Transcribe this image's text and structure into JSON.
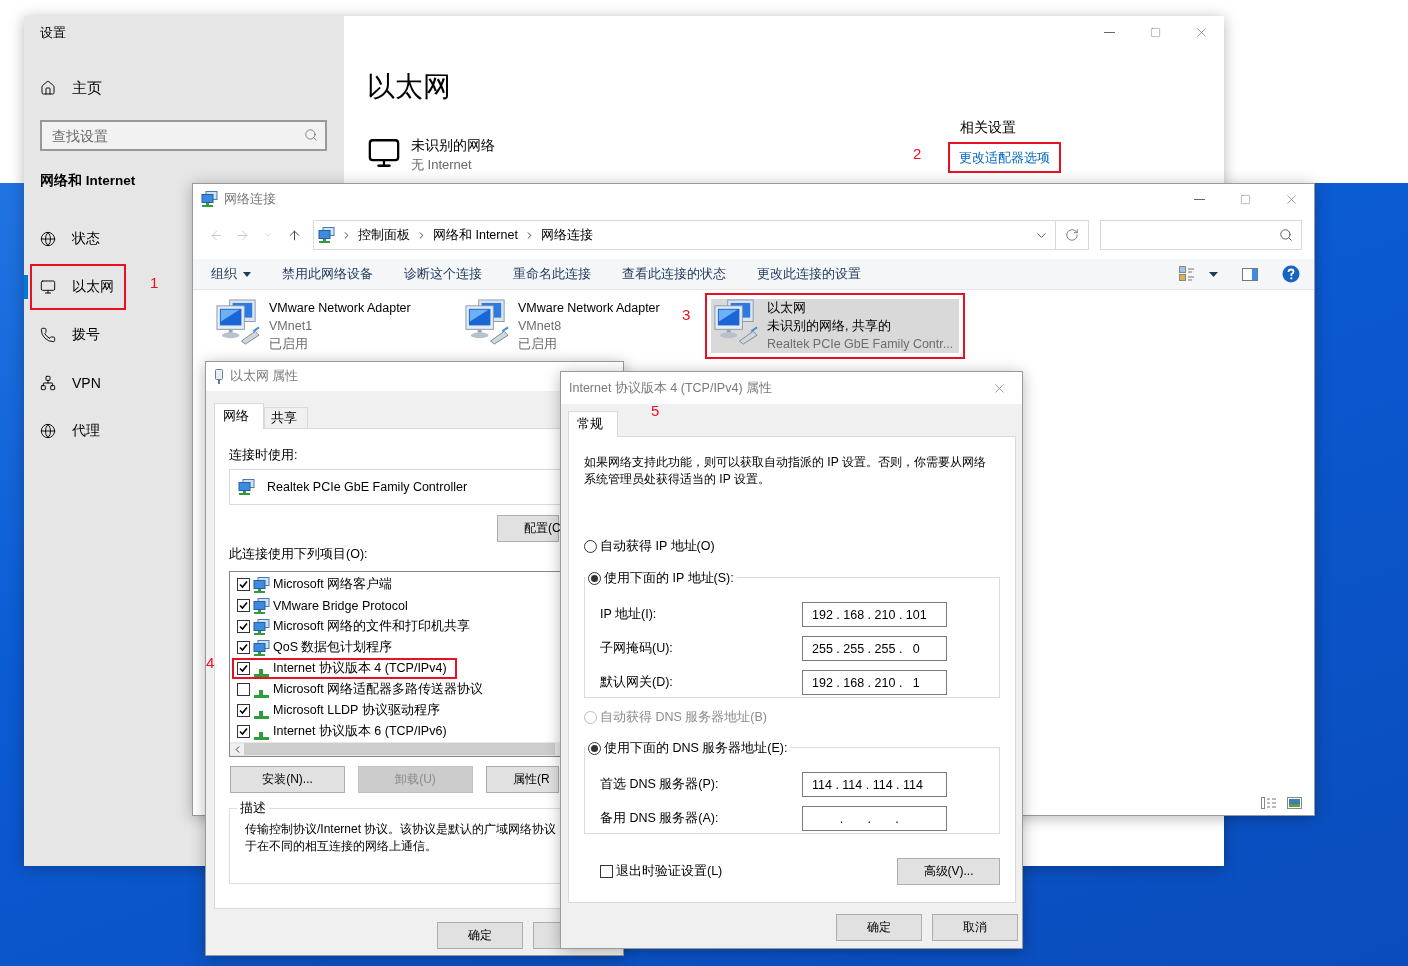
{
  "settings": {
    "title": "设置",
    "home": "主页",
    "search": {
      "placeholder": "查找设置"
    },
    "section": "网络和 Internet",
    "nav": [
      {
        "label": "状态",
        "kind": "status",
        "selected": false,
        "highlighted": false
      },
      {
        "label": "以太网",
        "kind": "ethernet",
        "selected": true,
        "highlighted": true
      },
      {
        "label": "拨号",
        "kind": "dialup",
        "selected": false,
        "highlighted": false
      },
      {
        "label": "VPN",
        "kind": "vpn",
        "selected": false,
        "highlighted": false
      },
      {
        "label": "代理",
        "kind": "proxy",
        "selected": false,
        "highlighted": false
      }
    ],
    "page_title": "以太网",
    "network": {
      "name": "未识别的网络",
      "status": "无 Internet"
    },
    "related": {
      "heading": "相关设置",
      "link": "更改适配器选项",
      "highlighted": true
    }
  },
  "network_connections": {
    "title": "网络连接",
    "breadcrumb": [
      "控制面板",
      "网络和 Internet",
      "网络连接"
    ],
    "toolbar": [
      {
        "label": "组织",
        "kind": "menu"
      },
      {
        "label": "禁用此网络设备",
        "kind": "action"
      },
      {
        "label": "诊断这个连接",
        "kind": "action"
      },
      {
        "label": "重命名此连接",
        "kind": "action"
      },
      {
        "label": "查看此连接的状态",
        "kind": "action"
      },
      {
        "label": "更改此连接的设置",
        "kind": "action"
      }
    ],
    "adapters": [
      {
        "name": "VMware Network Adapter",
        "line2": "VMnet1",
        "status": "已启用",
        "selected": false,
        "highlighted": false
      },
      {
        "name": "VMware Network Adapter",
        "line2": "VMnet8",
        "status": "已启用",
        "selected": false,
        "highlighted": false
      },
      {
        "name": "以太网",
        "line2": "未识别的网络, 共享的",
        "status": "Realtek PCIe GbE Family Contr...",
        "selected": true,
        "highlighted": true
      }
    ]
  },
  "ethernet_properties": {
    "title": "以太网 属性",
    "tabs": [
      {
        "label": "网络",
        "selected": true
      },
      {
        "label": "共享",
        "selected": false
      }
    ],
    "connect_using_label": "连接时使用:",
    "adapter": "Realtek PCIe GbE Family Controller",
    "configure_button": "配置(C",
    "items_label": "此连接使用下列项目(O):",
    "items": [
      {
        "label": "Microsoft 网络客户端",
        "kind": "service",
        "checked": true,
        "highlighted": false
      },
      {
        "label": "VMware Bridge Protocol",
        "kind": "service",
        "checked": true,
        "highlighted": false
      },
      {
        "label": "Microsoft 网络的文件和打印机共享",
        "kind": "service",
        "checked": true,
        "highlighted": false
      },
      {
        "label": "QoS 数据包计划程序",
        "kind": "service",
        "checked": true,
        "highlighted": false
      },
      {
        "label": "Internet 协议版本 4 (TCP/IPv4)",
        "kind": "protocol",
        "checked": true,
        "highlighted": true
      },
      {
        "label": "Microsoft 网络适配器多路传送器协议",
        "kind": "protocol",
        "checked": false,
        "highlighted": false
      },
      {
        "label": "Microsoft LLDP 协议驱动程序",
        "kind": "protocol",
        "checked": true,
        "highlighted": false
      },
      {
        "label": "Internet 协议版本 6 (TCP/IPv6)",
        "kind": "protocol",
        "checked": true,
        "highlighted": false
      }
    ],
    "buttons": [
      {
        "label": "安装(N)...",
        "disabled": false
      },
      {
        "label": "卸载(U)",
        "disabled": true
      },
      {
        "label": "属性(R",
        "disabled": false
      }
    ],
    "description_heading": "描述",
    "description_lines": [
      "传输控制协议/Internet 协议。该协议是默认的广域网络协议",
      "于在不同的相互连接的网络上通信。"
    ],
    "ok": "确定"
  },
  "ipv4_properties": {
    "title": "Internet 协议版本 4 (TCP/IPv4) 属性",
    "tabs": [
      {
        "label": "常规",
        "selected": true
      }
    ],
    "intro": "如果网络支持此功能，则可以获取自动指派的 IP 设置。否则，你需要从网络系统管理员处获得适当的 IP 设置。",
    "ip_mode": [
      {
        "label": "自动获得 IP 地址(O)",
        "selected": false,
        "disabled": false
      },
      {
        "label": "使用下面的 IP 地址(S):",
        "selected": true,
        "disabled": false
      }
    ],
    "ip_fields": [
      {
        "label": "IP 地址(I):",
        "value": "192 . 168 . 210 . 101"
      },
      {
        "label": "子网掩码(U):",
        "value": "255 . 255 . 255 .   0"
      },
      {
        "label": "默认网关(D):",
        "value": "192 . 168 . 210 .   1"
      }
    ],
    "dns_mode": [
      {
        "label": "自动获得 DNS 服务器地址(B)",
        "selected": false,
        "disabled": true
      },
      {
        "label": "使用下面的 DNS 服务器地址(E):",
        "selected": true,
        "disabled": false
      }
    ],
    "dns_fields": [
      {
        "label": "首选 DNS 服务器(P):",
        "value": "114 . 114 . 114 . 114"
      },
      {
        "label": "备用 DNS 服务器(A):",
        "value": "        .       .       ."
      }
    ],
    "validate": {
      "label": "退出时验证设置(L)",
      "checked": false
    },
    "advanced": "高级(V)...",
    "ok": "确定",
    "cancel": "取消"
  },
  "annotations": [
    "1",
    "2",
    "3",
    "4",
    "5"
  ]
}
